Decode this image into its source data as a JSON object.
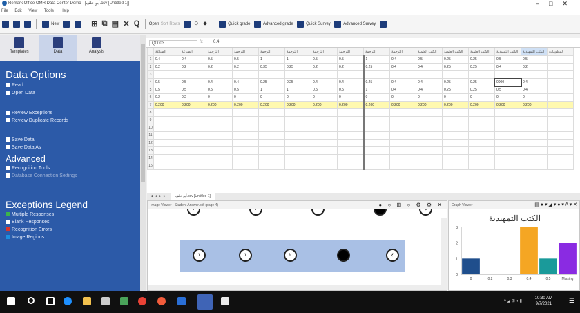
{
  "window": {
    "title": "Remark Office OMR Data Center Demo - [أبو خلف.csv [Untitled 1]]",
    "controls": [
      "–",
      "□",
      "✕"
    ]
  },
  "menu": [
    "File",
    "Edit",
    "View",
    "Tools",
    "Help"
  ],
  "toolbar": {
    "new_label": "New",
    "cut_label": "✕",
    "find_label": "Q",
    "open_label": "Open",
    "sort_label": "Sort Rows",
    "quick_grade": "Quick grade",
    "adv_grade": "Advanced grade",
    "quick_survey": "Quick Survey",
    "adv_survey": "Advanced Survey"
  },
  "sidebar": {
    "tabs": [
      {
        "label": "Templates",
        "icon": "templates-icon"
      },
      {
        "label": "Data",
        "icon": "data-icon"
      },
      {
        "label": "Analysis",
        "icon": "analysis-icon"
      }
    ],
    "data_options_title": "Data Options",
    "data_items": [
      "Read",
      "Open Data"
    ],
    "review_items": [
      "Review Exceptions",
      "Review Duplicate Records"
    ],
    "save_items": [
      "Save Data",
      "Save Data As"
    ],
    "advanced_title": "Advanced",
    "advanced_items": [
      "Recognition Tools",
      "Database Connection Settings"
    ],
    "legend_title": "Exceptions Legend",
    "legend_items": [
      {
        "label": "Multiple Responses",
        "color": "#3cb44b"
      },
      {
        "label": "Blank Responses",
        "color": "#ffffff"
      },
      {
        "label": "Recognition Errors",
        "color": "#d9342b"
      },
      {
        "label": "Image Regions",
        "color": "#1c8fe0"
      }
    ]
  },
  "formula": {
    "namebox": "Q0003",
    "fx": "fx",
    "value": "0.4"
  },
  "grid": {
    "headers": [
      "الطباعة",
      "الطباعة",
      "الترجمة",
      "الترجمة",
      "الترجمة",
      "الترجمة",
      "الترجمة",
      "الترجمة",
      "الترجمة",
      "الترجمة",
      "الكتب العلمية",
      "الكتب العلمية",
      "الكتب العلمية",
      "الكتب التمهيدية",
      "الكتب التمهيدية",
      "المعلومات"
    ],
    "rows": [
      {
        "n": "1",
        "cells": [
          "0.4",
          "0.4",
          "0.5",
          "0.5",
          "1",
          "1",
          "0.5",
          "0.5",
          "1",
          "0.4",
          "0.5",
          "0.25",
          "0.25",
          "0.5",
          "0.5"
        ]
      },
      {
        "n": "2",
        "cells": [
          "0.2",
          "0.2",
          "0.2",
          "0.2",
          "0.35",
          "0.25",
          "0.2",
          "0.2",
          "0.25",
          "0.4",
          "0.4",
          "0.25",
          "0.25",
          "0.4",
          "0.2"
        ]
      },
      {
        "n": "3",
        "cells": [
          "",
          "",
          "",
          "",
          "",
          "",
          "",
          "",
          "",
          "",
          "",
          "",
          "",
          "",
          ""
        ]
      },
      {
        "n": "4",
        "cells": [
          "0.5",
          "0.5",
          "0.4",
          "0.4",
          "0.25",
          "0.25",
          "0.4",
          "0.4",
          "0.25",
          "0.4",
          "0.4",
          "0.25",
          "0.25",
          "0.5",
          "0.4"
        ]
      },
      {
        "n": "5",
        "cells": [
          "0.5",
          "0.5",
          "0.5",
          "0.5",
          "1",
          "1",
          "0.5",
          "0.5",
          "1",
          "0.4",
          "0.4",
          "0.25",
          "0.25",
          "0.5",
          "0.4"
        ]
      },
      {
        "n": "6",
        "cells": [
          "0.2",
          "0.2",
          "0",
          "0",
          "0",
          "0",
          "0",
          "0",
          "0",
          "0",
          "0",
          "0",
          "0",
          "0",
          "0"
        ]
      },
      {
        "n": "7",
        "cells": [
          "0.200",
          "0.200",
          "0.200",
          "0.200",
          "0.200",
          "0.200",
          "0.200",
          "0.200",
          "0.200",
          "0.200",
          "0.200",
          "0.200",
          "0.200",
          "0.200",
          "0.200"
        ]
      },
      {
        "n": "8",
        "cells": [
          "",
          "",
          "",
          "",
          "",
          "",
          "",
          "",
          "",
          "",
          "",
          "",
          "",
          "",
          ""
        ]
      },
      {
        "n": "9",
        "cells": [
          "",
          "",
          "",
          "",
          "",
          "",
          "",
          "",
          "",
          "",
          "",
          "",
          "",
          "",
          ""
        ]
      },
      {
        "n": "10",
        "cells": [
          "",
          "",
          "",
          "",
          "",
          "",
          "",
          "",
          "",
          "",
          "",
          "",
          "",
          "",
          ""
        ]
      },
      {
        "n": "11",
        "cells": [
          "",
          "",
          "",
          "",
          "",
          "",
          "",
          "",
          "",
          "",
          "",
          "",
          "",
          "",
          ""
        ]
      },
      {
        "n": "12",
        "cells": [
          "",
          "",
          "",
          "",
          "",
          "",
          "",
          "",
          "",
          "",
          "",
          "",
          "",
          "",
          ""
        ]
      },
      {
        "n": "13",
        "cells": [
          "",
          "",
          "",
          "",
          "",
          "",
          "",
          "",
          "",
          "",
          "",
          "",
          "",
          "",
          ""
        ]
      },
      {
        "n": "14",
        "cells": [
          "",
          "",
          "",
          "",
          "",
          "",
          "",
          "",
          "",
          "",
          "",
          "",
          "",
          "",
          ""
        ]
      },
      {
        "n": "15",
        "cells": [
          "",
          "",
          "",
          "",
          "",
          "",
          "",
          "",
          "",
          "",
          "",
          "",
          "",
          "",
          ""
        ]
      }
    ],
    "edit_value": "0.4",
    "edit_prev": "0000"
  },
  "sheettab": "أبو خلف.csv [Untitled 1]",
  "image_pane": {
    "title": "Image Viewer - Student Answer.pdf (page 4)",
    "row1": [
      "١",
      "١",
      "١",
      "",
      "٤"
    ],
    "row2": [
      "١",
      "١",
      "٢",
      "",
      "٤"
    ]
  },
  "graph_pane": {
    "title": "Graph Viewer",
    "chart_title": "الكتب التمهيدية"
  },
  "chart_data": {
    "type": "bar",
    "title": "الكتب التمهيدية",
    "categories": [
      "0",
      "0.2",
      "0.3",
      "0.4",
      "0.5",
      "Missing"
    ],
    "values": [
      1,
      0,
      0,
      3,
      1,
      2
    ],
    "colors": [
      "#1f4e8c",
      "#1f4e8c",
      "#1f4e8c",
      "#f5a623",
      "#1a9a9a",
      "#8a2be2"
    ],
    "ylabels": [
      "0",
      "1",
      "2",
      "3"
    ],
    "ylim": [
      0,
      3
    ]
  },
  "taskbar": {
    "time": "10:30 AM",
    "date": "9/7/2021"
  }
}
